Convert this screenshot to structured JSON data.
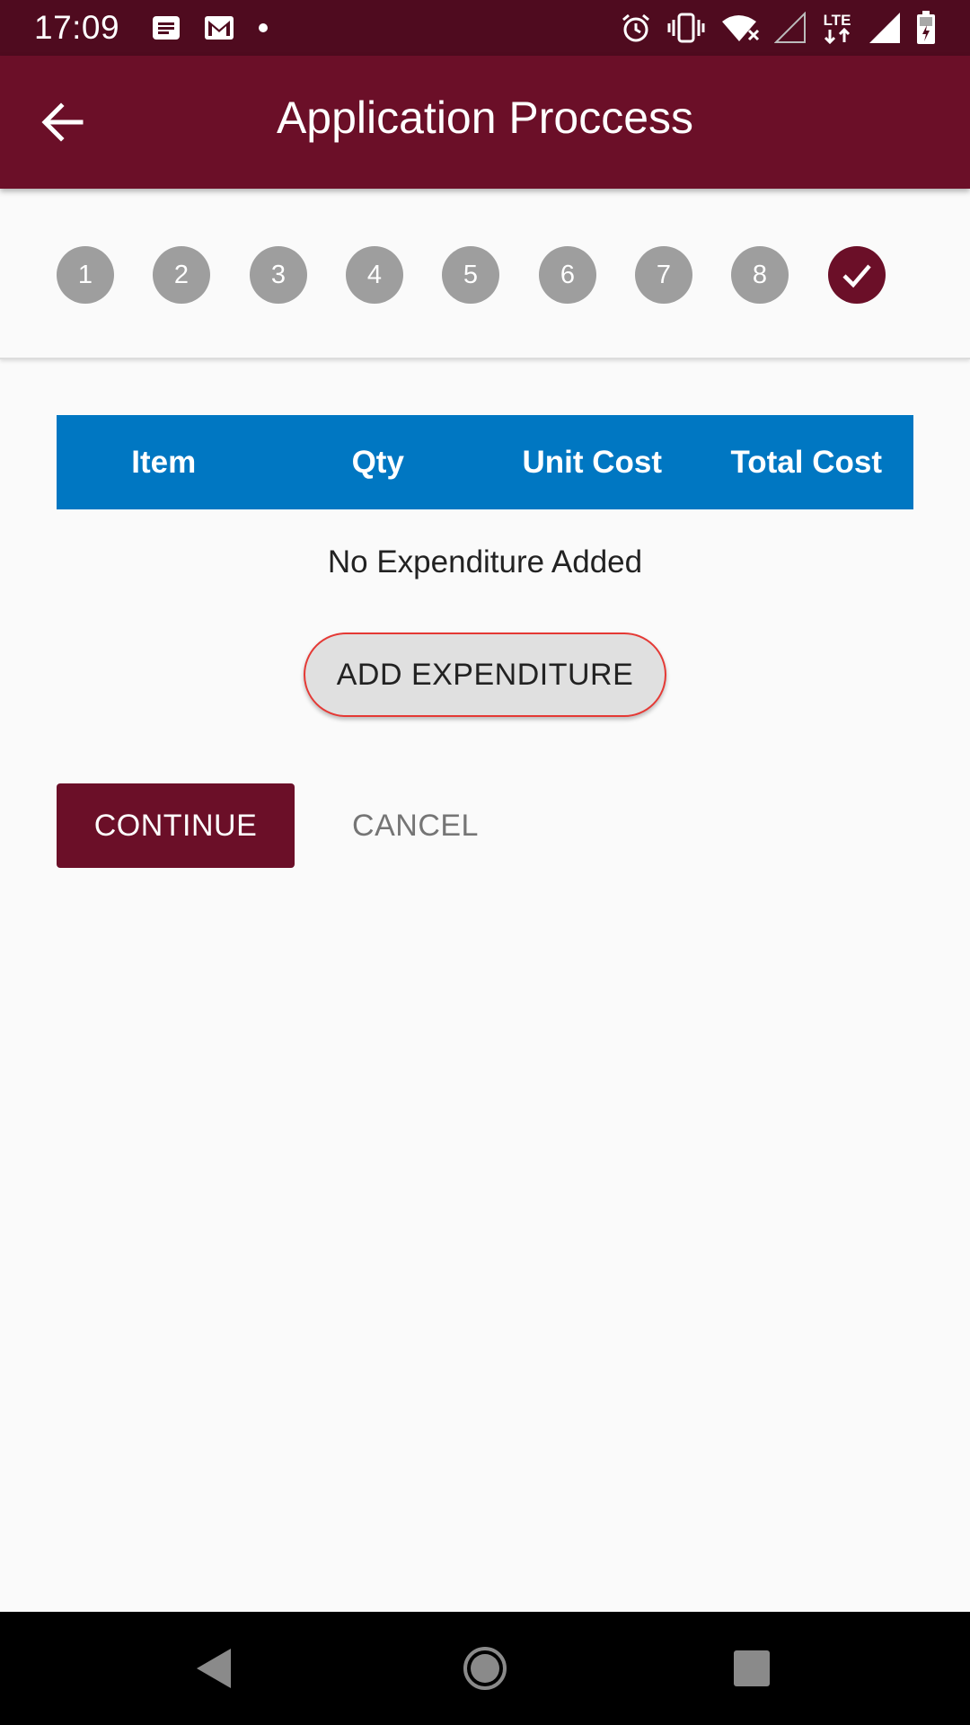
{
  "status_bar": {
    "time": "17:09",
    "lte": "LTE",
    "icons_left": [
      "message-icon",
      "gmail-icon",
      "dot-icon"
    ],
    "icons_right": [
      "alarm-icon",
      "vibrate-icon",
      "wifi-icon",
      "signal-empty-icon",
      "lte-icon",
      "signal-full-icon",
      "battery-icon"
    ]
  },
  "app_bar": {
    "title": "Application Proccess",
    "back_icon": "arrow-left-icon"
  },
  "stepper": {
    "steps": [
      "1",
      "2",
      "3",
      "4",
      "5",
      "6",
      "7",
      "8"
    ],
    "final_step_icon": "check-icon",
    "active_color": "#6b0f28",
    "inactive_color": "#9e9e9e"
  },
  "table": {
    "headers": [
      "Item",
      "Qty",
      "Unit Cost",
      "Total Cost"
    ],
    "header_color": "#0077c2",
    "empty_message": "No Expenditure Added"
  },
  "actions": {
    "add_label": "ADD EXPENDITURE",
    "continue_label": "CONTINUE",
    "cancel_label": "CANCEL"
  },
  "nav_bar": {
    "icons": [
      "back-triangle-icon",
      "home-circle-icon",
      "recents-square-icon"
    ]
  }
}
